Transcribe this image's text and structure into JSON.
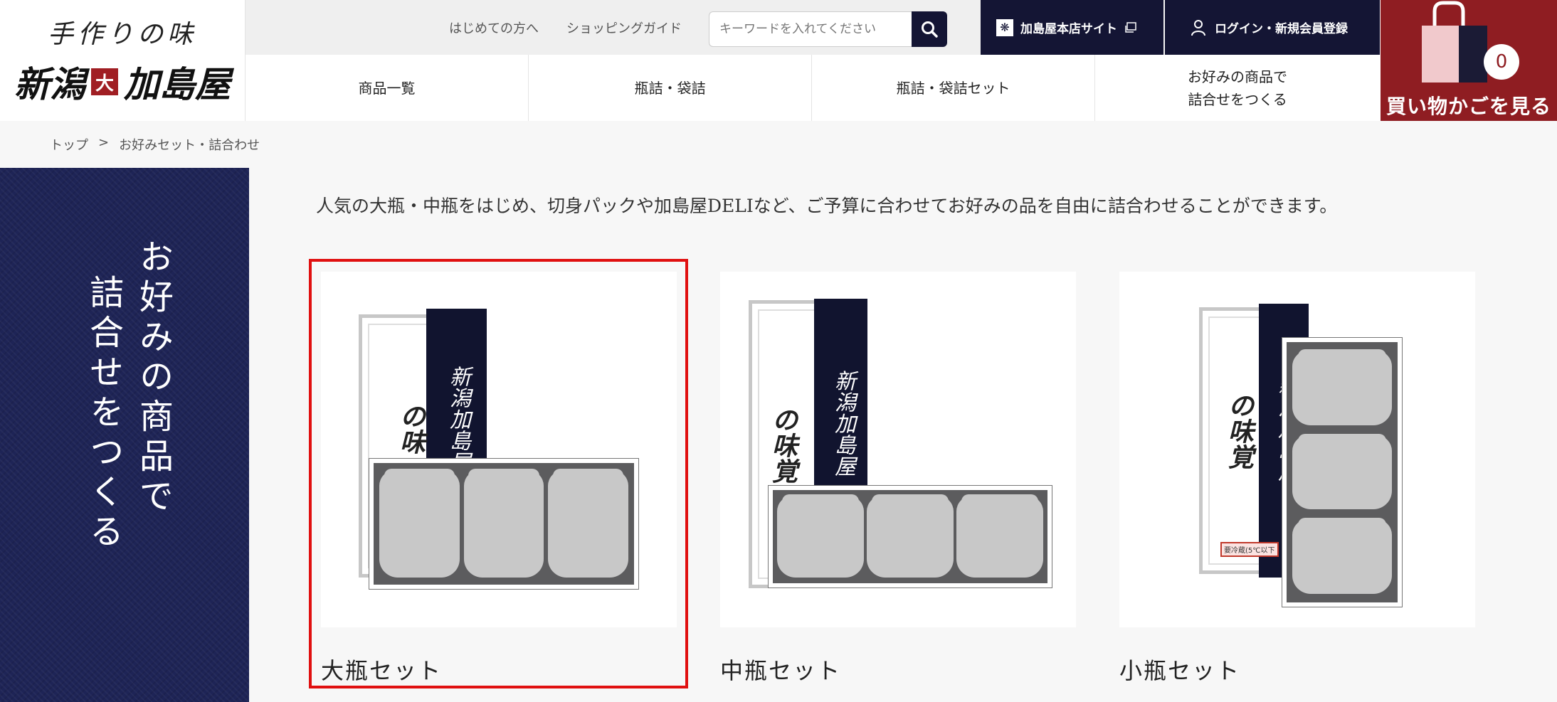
{
  "header": {
    "logo": {
      "sub": "手作りの味",
      "main_left": "新潟",
      "seal": "大",
      "main_right": "加島屋"
    },
    "util_links": [
      "はじめての方へ",
      "ショッピングガイド"
    ],
    "search": {
      "placeholder": "キーワードを入れてください"
    },
    "honten": {
      "label": "加島屋本店サイト"
    },
    "login": {
      "label": "ログイン・新規会員登録"
    },
    "cart": {
      "count": "0",
      "label": "買い物かごを見る"
    },
    "gnav": [
      {
        "label": "商品一覧"
      },
      {
        "label": "瓶詰・袋詰"
      },
      {
        "label": "瓶詰・袋詰セット"
      },
      {
        "line1": "お好みの商品で",
        "line2": "詰合せをつくる"
      }
    ]
  },
  "breadcrumb": {
    "home": "トップ",
    "separator": ">",
    "current": "お好みセット・詰合わせ"
  },
  "banner": {
    "line1": "お好みの商品で",
    "line2": "詰合せをつくる"
  },
  "intro": "人気の大瓶・中瓶をはじめ、切身パックや加島屋DELIなど、ご予算に合わせてお好みの品を自由に詰合わせることができます。",
  "illustration": {
    "noshi": "新潟加島屋",
    "aji_a": "の味",
    "aji_b": "の味覚",
    "chilled": "要冷蔵(5℃以下"
  },
  "products": [
    {
      "name": "大瓶セット",
      "selected": true
    },
    {
      "name": "中瓶セット",
      "selected": false
    },
    {
      "name": "小瓶セット",
      "selected": false
    }
  ],
  "colors": {
    "navy": "#141534",
    "cart_red": "#8f1d22",
    "highlight": "#e01010"
  }
}
